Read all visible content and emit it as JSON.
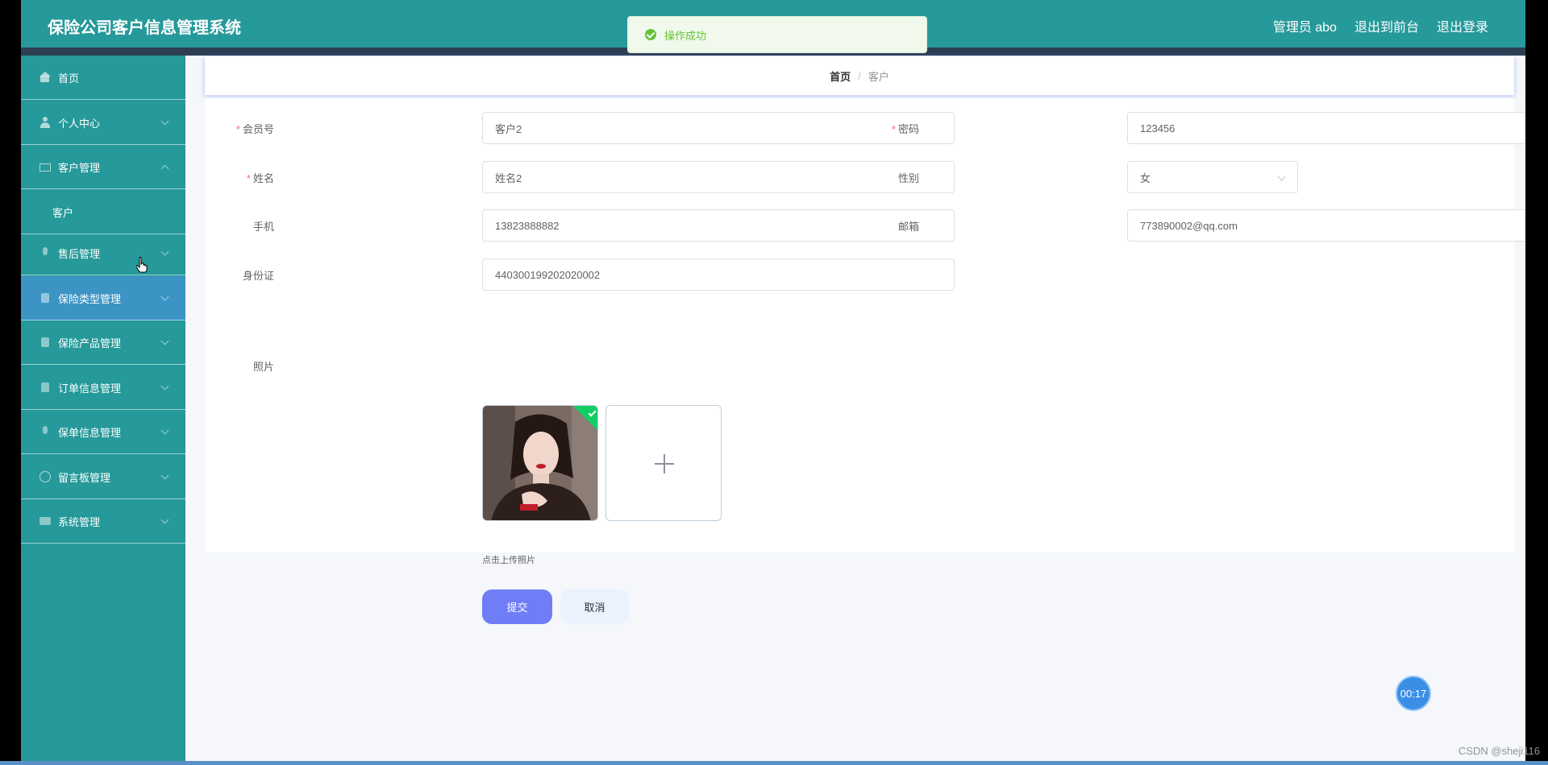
{
  "header": {
    "title": "保险公司客户信息管理系统",
    "user": "管理员 abo",
    "to_front": "退出到前台",
    "logout": "退出登录",
    "bar_color": "#26999a"
  },
  "toast": {
    "message": "操作成功",
    "type": "success"
  },
  "sidebar": {
    "items": [
      {
        "label": "首页",
        "icon": "home-icon"
      },
      {
        "label": "个人中心",
        "icon": "user-icon"
      },
      {
        "label": "客户管理",
        "icon": "mail-icon",
        "expanded": true,
        "children": [
          {
            "label": "客户"
          }
        ]
      },
      {
        "label": "售后管理",
        "icon": "phone-icon"
      },
      {
        "label": "保险类型管理",
        "icon": "clipboard-icon",
        "active": true
      },
      {
        "label": "保险产品管理",
        "icon": "card-icon"
      },
      {
        "label": "订单信息管理",
        "icon": "pin-icon"
      },
      {
        "label": "保单信息管理",
        "icon": "microphone-icon"
      },
      {
        "label": "留言板管理",
        "icon": "gauge-icon"
      },
      {
        "label": "系统管理",
        "icon": "chat-icon"
      }
    ]
  },
  "breadcrumb": {
    "home": "首页",
    "separator": "/",
    "current": "客户"
  },
  "form": {
    "member_no": {
      "label": "会员号",
      "value": "客户2",
      "required": true
    },
    "password": {
      "label": "密码",
      "value": "123456",
      "required": true
    },
    "name": {
      "label": "姓名",
      "value": "姓名2",
      "required": true
    },
    "gender": {
      "label": "性别",
      "value": "女"
    },
    "phone": {
      "label": "手机",
      "value": "13823888882"
    },
    "email": {
      "label": "邮箱",
      "value": "773890002@qq.com"
    },
    "id_card": {
      "label": "身份证",
      "value": "440300199202020002"
    },
    "photo": {
      "label": "照片",
      "hint": "点击上传照片"
    },
    "submit": "提交",
    "cancel": "取消"
  },
  "timer": "00:17",
  "watermark": "CSDN @sheji116"
}
